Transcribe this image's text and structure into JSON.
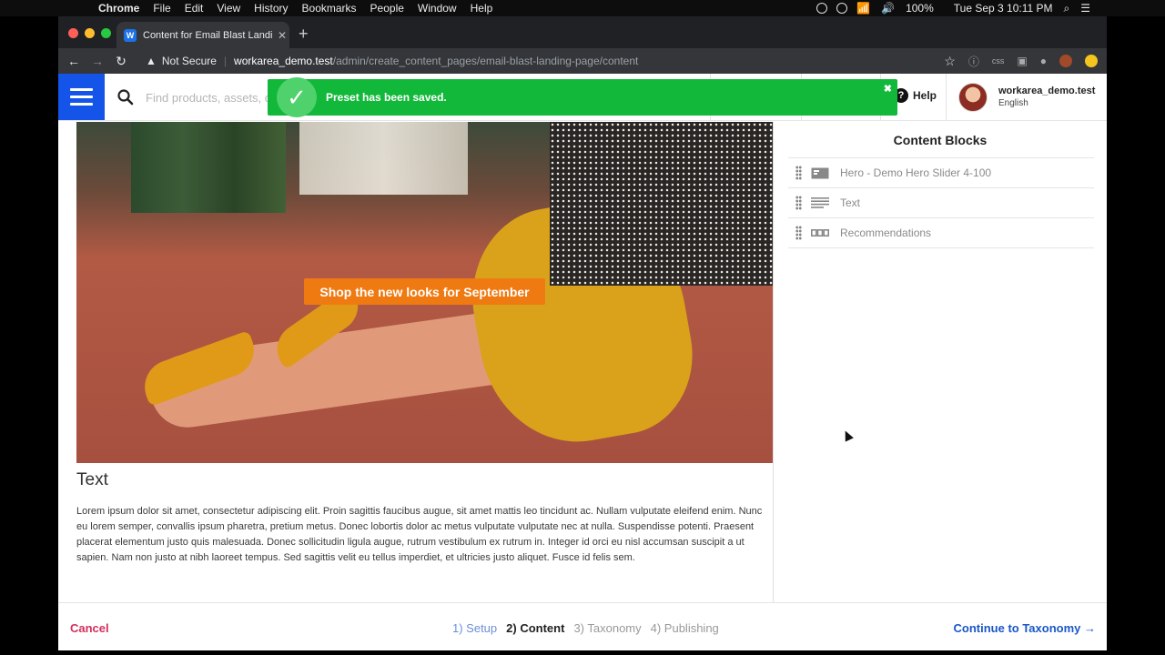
{
  "menubar": {
    "items": [
      "Chrome",
      "File",
      "Edit",
      "View",
      "History",
      "Bookmarks",
      "People",
      "Window",
      "Help"
    ],
    "battery": "100%",
    "clock": "Tue Sep 3  10:11 PM"
  },
  "browser": {
    "tab_title": "Content for Email Blast Landing",
    "tab_favicon": "W",
    "security_label": "Not Secure",
    "url_host": "workarea_demo.test",
    "url_path": "/admin/create_content_pages/email-blast-landing-page/content"
  },
  "header": {
    "search_placeholder": "Find products, assets, ca",
    "help_label": "Help",
    "user_name": "workarea_demo.test",
    "user_locale": "English"
  },
  "toast": {
    "message": "Preset has been saved.",
    "close_glyph": "✖",
    "color": "#12b83a"
  },
  "preview": {
    "hero_cta": "Shop the new looks for September",
    "text_heading": "Text",
    "text_body": "Lorem ipsum dolor sit amet, consectetur adipiscing elit. Proin sagittis faucibus augue, sit amet mattis leo tincidunt ac. Nullam vulputate eleifend enim. Nunc eu lorem semper, convallis ipsum pharetra, pretium metus. Donec lobortis dolor ac metus vulputate vulputate nec at nulla. Suspendisse potenti. Praesent placerat elementum justo quis malesuada. Donec sollicitudin ligula augue, rutrum vestibulum ex rutrum in. Integer id orci eu nisl accumsan suscipit a ut sapien. Nam non justo at nibh laoreet tempus. Sed sagittis velit eu tellus imperdiet, et ultricies justo aliquet. Fusce id felis sem."
  },
  "content_blocks": {
    "title": "Content Blocks",
    "items": [
      {
        "label": "Hero - Demo Hero Slider 4-100",
        "icon": "hero-image-icon"
      },
      {
        "label": "Text",
        "icon": "text-lines-icon"
      },
      {
        "label": "Recommendations",
        "icon": "recommendations-icon"
      }
    ]
  },
  "footer": {
    "cancel": "Cancel",
    "steps": [
      "1) Setup",
      "2) Content",
      "3) Taxonomy",
      "4) Publishing"
    ],
    "active_step": "2) Content",
    "continue": "Continue to Taxonomy →"
  },
  "colors": {
    "brand_blue": "#1454e8",
    "cancel_red": "#d32f5c",
    "cta_orange": "#f07a12"
  }
}
